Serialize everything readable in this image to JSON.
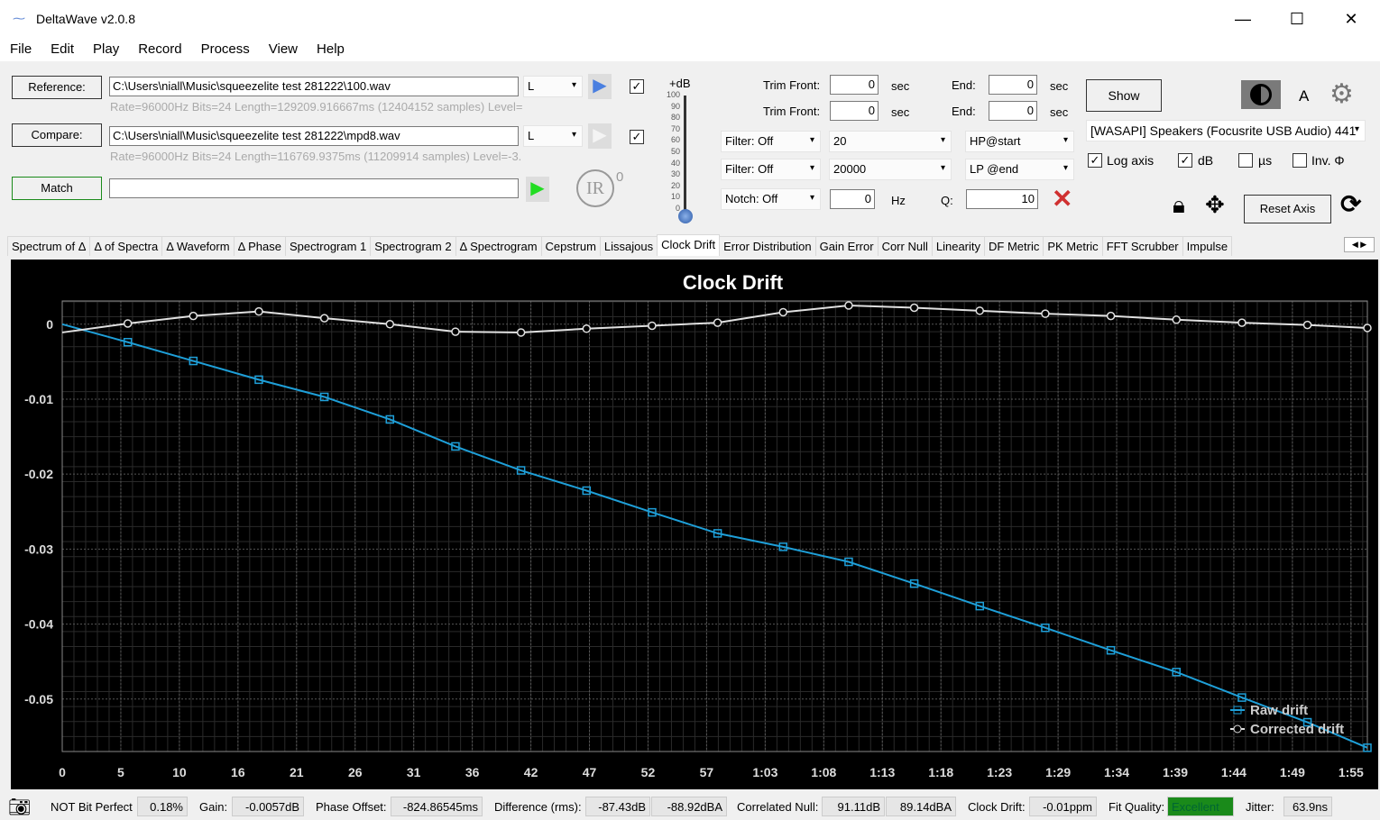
{
  "window": {
    "title": "DeltaWave v2.0.8",
    "minimize": "—",
    "maximize": "☐",
    "close": "✕"
  },
  "menu": [
    "File",
    "Edit",
    "Play",
    "Record",
    "Process",
    "View",
    "Help"
  ],
  "reference": {
    "button": "Reference:",
    "path": "C:\\Users\\niall\\Music\\squeezelite test 281222\\100.wav",
    "channel": "L",
    "info": "Rate=96000Hz Bits=24 Length=129209.916667ms (12404152 samples) Level=",
    "checked": true
  },
  "compare": {
    "button": "Compare:",
    "path": "C:\\Users\\niall\\Music\\squeezelite test 281222\\mpd8.wav",
    "channel": "L",
    "info": "Rate=96000Hz Bits=24 Length=116769.9375ms (11209914 samples) Level=-3.",
    "checked": true
  },
  "match": {
    "button": "Match",
    "value": ""
  },
  "ir": {
    "label": "IR",
    "count": "0"
  },
  "level_slider": {
    "title": "+dB",
    "ticks": [
      "100",
      "90",
      "80",
      "70",
      "60",
      "50",
      "40",
      "30",
      "20",
      "10",
      "0"
    ],
    "value": 0
  },
  "trim": [
    {
      "front_label": "Trim Front:",
      "front": "0",
      "unit": "sec",
      "end_label": "End:",
      "end": "0",
      "end_unit": "sec"
    },
    {
      "front_label": "Trim Front:",
      "front": "0",
      "unit": "sec",
      "end_label": "End:",
      "end": "0",
      "end_unit": "sec"
    }
  ],
  "filters": [
    {
      "type": "Filter: Off",
      "freq": "20",
      "mode": "HP@start"
    },
    {
      "type": "Filter: Off",
      "freq": "20000",
      "mode": "LP @end"
    }
  ],
  "notch": {
    "type": "Notch: Off",
    "freq": "0",
    "unit": "Hz",
    "q_label": "Q:",
    "q": "10"
  },
  "show_button": "Show",
  "a_label": "A",
  "device": "[WASAPI] Speakers (Focusrite USB Audio) 441",
  "options": [
    {
      "label": "Log axis",
      "checked": true
    },
    {
      "label": "dB",
      "checked": true
    },
    {
      "label": "µs",
      "checked": false
    },
    {
      "label": "Inv. Φ",
      "checked": false
    }
  ],
  "reset_axis": "Reset Axis",
  "tabs": [
    "Spectrum of Δ",
    "Δ of Spectra",
    "Δ Waveform",
    "Δ Phase",
    "Spectrogram 1",
    "Spectrogram 2",
    "Δ Spectrogram",
    "Cepstrum",
    "Lissajous",
    "Clock Drift",
    "Error Distribution",
    "Gain Error",
    "Corr Null",
    "Linearity",
    "DF Metric",
    "PK Metric",
    "FFT Scrubber",
    "Impulse"
  ],
  "active_tab": "Clock Drift",
  "chart_data": {
    "type": "line",
    "title": "Clock Drift",
    "xlabel": "",
    "ylabel": "",
    "grid": true,
    "legend_placement": "bottom-right",
    "xlim": [
      0,
      116.3
    ],
    "ylim": [
      -0.057,
      0.0031
    ],
    "xticks": [
      0,
      5.22,
      10.44,
      15.66,
      20.88,
      26.1,
      31.32,
      36.54,
      41.76,
      46.98,
      52.2,
      57.42,
      62.64,
      67.86,
      73.08,
      78.3,
      83.52,
      88.74,
      93.96,
      99.18,
      104.4,
      109.62,
      114.84
    ],
    "xtick_labels": [
      "0",
      "5",
      "10",
      "16",
      "21",
      "26",
      "31",
      "36",
      "42",
      "47",
      "52",
      "57",
      "1:03",
      "1:08",
      "1:13",
      "1:18",
      "1:23",
      "1:29",
      "1:34",
      "1:39",
      "1:44",
      "1:49",
      "1:55"
    ],
    "yticks": [
      0,
      -0.01,
      -0.02,
      -0.03,
      -0.04,
      -0.05
    ],
    "ytick_labels": [
      "0",
      "-0.01",
      "-0.02",
      "-0.03",
      "-0.04",
      "-0.05"
    ],
    "x": [
      0,
      5.84,
      11.68,
      17.52,
      23.36,
      29.2,
      35.04,
      40.88,
      46.72,
      52.56,
      58.4,
      64.24,
      70.08,
      75.92,
      81.76,
      87.6,
      93.44,
      99.28,
      105.12,
      110.96,
      116.3
    ],
    "series": [
      {
        "name": "Raw drift",
        "color": "#1e9fd8",
        "marker": "square",
        "values": [
          0,
          -0.0024,
          -0.0049,
          -0.0074,
          -0.0097,
          -0.0127,
          -0.0163,
          -0.0195,
          -0.0222,
          -0.0251,
          -0.0279,
          -0.0297,
          -0.0317,
          -0.0346,
          -0.0376,
          -0.0405,
          -0.0435,
          -0.0464,
          -0.0498,
          -0.0531,
          -0.0565
        ]
      },
      {
        "name": "Corrected drift",
        "color": "#e0e0e0",
        "marker": "circle",
        "values": [
          -0.0011,
          0.0001,
          0.0011,
          0.0017,
          0.0008,
          0,
          -0.001,
          -0.0011,
          -0.0006,
          -0.0002,
          0.0002,
          0.0016,
          0.0025,
          0.0022,
          0.0018,
          0.0014,
          0.0011,
          0.0006,
          0.0002,
          -0.0001,
          -0.0005
        ]
      }
    ]
  },
  "status": {
    "bit_perfect": "NOT Bit Perfect",
    "bit_perfect_value": "0.18%",
    "gain_label": "Gain:",
    "gain": "-0.0057dB",
    "phase_label": "Phase Offset:",
    "phase": "-824.86545ms",
    "diff_label": "Difference (rms):",
    "diff_db": "-87.43dB",
    "diff_dba": "-88.92dBA",
    "null_label": "Correlated Null:",
    "null_db": "91.11dB",
    "null_dba": "89.14dBA",
    "drift_label": "Clock Drift:",
    "drift": "-0.01ppm",
    "fit_label": "Fit Quality:",
    "fit": "Excellent",
    "fit_color": "#1a8a1a",
    "jitter_label": "Jitter:",
    "jitter": "63.9ns"
  }
}
